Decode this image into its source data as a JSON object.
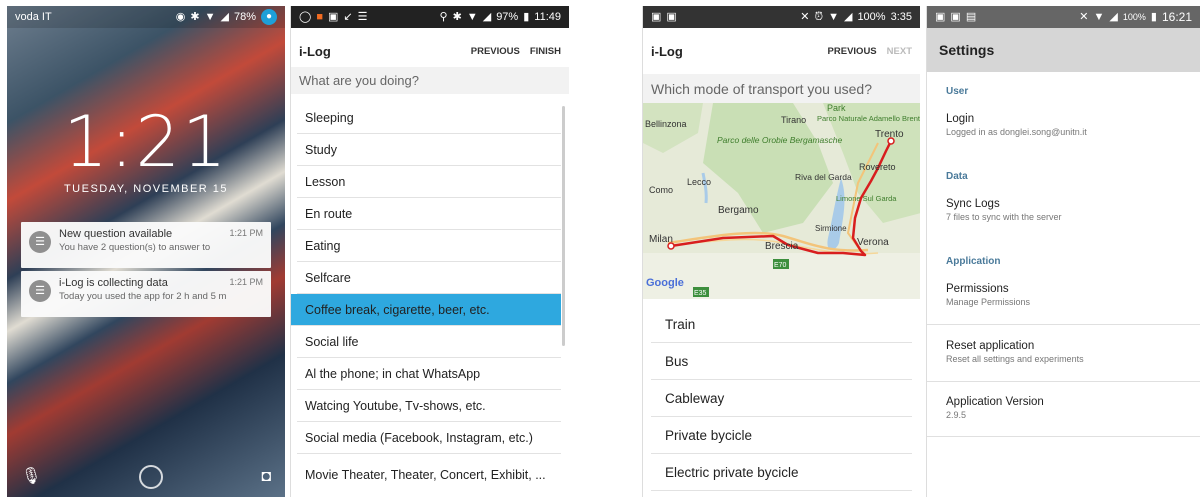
{
  "lock": {
    "carrier": "voda IT",
    "battery": "78%",
    "time": "1:21",
    "date": "TUESDAY, NOVEMBER 15",
    "notifications": [
      {
        "title": "New question available",
        "time": "1:21 PM",
        "text": "You have 2 question(s) to answer to"
      },
      {
        "title": "i-Log is collecting data",
        "time": "1:21 PM",
        "text": "Today you used the app for 2 h and 5 m"
      }
    ]
  },
  "activity": {
    "status": {
      "battery": "97%",
      "time": "11:49"
    },
    "app_title": "i-Log",
    "previous": "PREVIOUS",
    "finish": "FINISH",
    "question": "What are you doing?",
    "items": [
      "Sleeping",
      "Study",
      "Lesson",
      "En route",
      "Eating",
      "Selfcare",
      "Coffee break, cigarette, beer, etc.",
      "Social life",
      "Al the phone; in chat WhatsApp",
      "Watcing Youtube, Tv-shows, etc.",
      "Social media (Facebook, Instagram, etc.)",
      "Movie Theater, Theater, Concert, Exhibit, ..."
    ],
    "selected_index": 6
  },
  "transport": {
    "status": {
      "battery": "100%",
      "time": "3:35"
    },
    "app_title": "i-Log",
    "previous": "PREVIOUS",
    "next": "NEXT",
    "question": "Which mode of transport you used?",
    "map_labels": {
      "park": "Park",
      "tirano": "Tirano",
      "parco_naturale": "Parco Naturale Adamello Brenta",
      "bellinzona": "Bellinzona",
      "trento": "Trento",
      "parco_orobie": "Parco delle Orobie Bergamasche",
      "rovereto": "Rovereto",
      "lecco": "Lecco",
      "riva": "Riva del Garda",
      "como": "Como",
      "limone": "Limone Sul Garda",
      "bergamo": "Bergamo",
      "sirmione": "Sirmione",
      "milan": "Milan",
      "brescia": "Brescia",
      "verona": "Verona",
      "e70": "E70",
      "e35": "E35",
      "google": "Google"
    },
    "items": [
      "Train",
      "Bus",
      "Cableway",
      "Private bycicle",
      "Electric private bycicle"
    ]
  },
  "settings": {
    "status": {
      "battery": "100%",
      "time": "16:21"
    },
    "title": "Settings",
    "sections": {
      "user": "User",
      "data": "Data",
      "application": "Application"
    },
    "login": {
      "title": "Login",
      "sub": "Logged in as donglei.song@unitn.it"
    },
    "sync": {
      "title": "Sync Logs",
      "sub": "7 files to sync with the server"
    },
    "permissions": {
      "title": "Permissions",
      "sub": "Manage Permissions"
    },
    "reset": {
      "title": "Reset application",
      "sub": "Reset all settings and experiments"
    },
    "version": {
      "title": "Application Version",
      "sub": "2.9.5"
    }
  }
}
